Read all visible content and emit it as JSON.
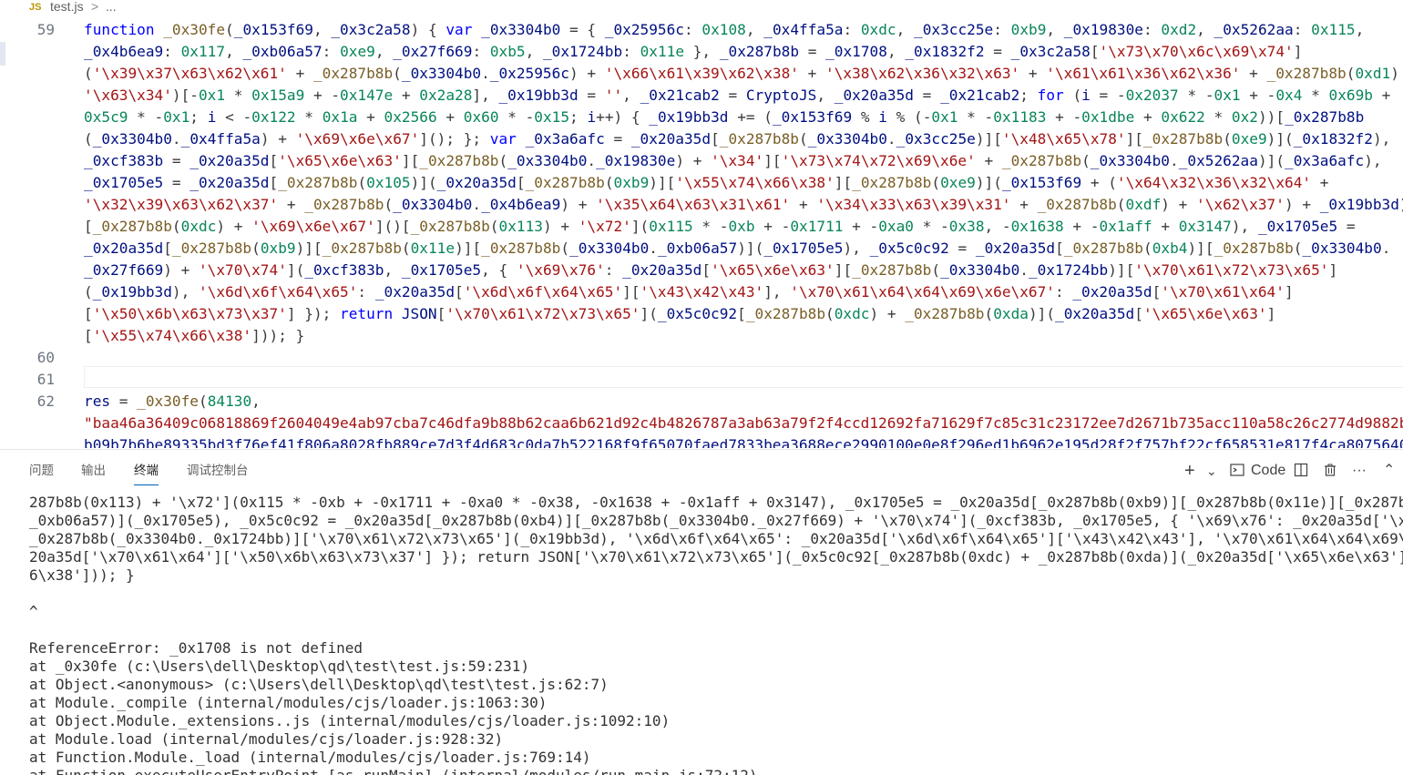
{
  "breadcrumb": {
    "icon_label": "JS",
    "file": "test.js",
    "separator": ">",
    "more": "..."
  },
  "editor": {
    "line_numbers": [
      "59",
      "60",
      "61",
      "62"
    ],
    "line59": [
      "function _0x30fe(_0x153f69, _0x3c2a58) { var _0x3304b0 = { _0x25956c: 0x108, _0x4ffa5a: 0xdc, _0x3cc25e: 0xb9, _0x19830e: 0xd2, _0x5262aa: 0x115,",
      "_0x4b6ea9: 0x117, _0xb06a57: 0xe9, _0x27f669: 0xb5, _0x1724bb: 0x11e }, _0x287b8b = _0x1708, _0x1832f2 = _0x3c2a58['\\x73\\x70\\x6c\\x69\\x74']",
      "('\\x39\\x37\\x63\\x62\\x61' + _0x287b8b(_0x3304b0._0x25956c) + '\\x66\\x61\\x39\\x62\\x38' + '\\x38\\x62\\x36\\x32\\x63' + '\\x61\\x61\\x36\\x62\\x36' + _0x287b8b(0xd1) +",
      "'\\x63\\x34')[-0x1 * 0x15a9 + -0x147e + 0x2a28], _0x19bb3d = '', _0x21cab2 = CryptoJS, _0x20a35d = _0x21cab2; for (i = -0x2037 * -0x1 + -0x4 * 0x69b +",
      "0x5c9 * -0x1; i < -0x122 * 0x1a + 0x2566 + 0x60 * -0x15; i++) { _0x19bb3d += (_0x153f69 % i % (-0x1 * -0x1183 + -0x1dbe + 0x622 * 0x2))[_0x287b8b",
      "(_0x3304b0._0x4ffa5a) + '\\x69\\x6e\\x67'](); }; var _0x3a6afc = _0x20a35d[_0x287b8b(_0x3304b0._0x3cc25e)]['\\x48\\x65\\x78'][_0x287b8b(0xe9)](_0x1832f2),",
      "_0xcf383b = _0x20a35d['\\x65\\x6e\\x63'][_0x287b8b(_0x3304b0._0x19830e) + '\\x34']['\\x73\\x74\\x72\\x69\\x6e' + _0x287b8b(_0x3304b0._0x5262aa)](_0x3a6afc),",
      "_0x1705e5 = _0x20a35d[_0x287b8b(0x105)](_0x20a35d[_0x287b8b(0xb9)]['\\x55\\x74\\x66\\x38'][_0x287b8b(0xe9)](_0x153f69 + ('\\x64\\x32\\x36\\x32\\x64' +",
      "'\\x32\\x39\\x63\\x62\\x37' + _0x287b8b(_0x3304b0._0x4b6ea9) + '\\x35\\x64\\x63\\x31\\x61' + '\\x34\\x33\\x63\\x39\\x31' + _0x287b8b(0xdf) + '\\x62\\x37') + _0x19bb3d)",
      "[_0x287b8b(0xdc) + '\\x69\\x6e\\x67']()[_0x287b8b(0x113) + '\\x72'](0x115 * -0xb + -0x1711 + -0xa0 * -0x38, -0x1638 + -0x1aff + 0x3147), _0x1705e5 =",
      "_0x20a35d[_0x287b8b(0xb9)][_0x287b8b(0x11e)][_0x287b8b(_0x3304b0._0xb06a57)](_0x1705e5), _0x5c0c92 = _0x20a35d[_0x287b8b(0xb4)][_0x287b8b(_0x3304b0.",
      "_0x27f669) + '\\x70\\x74'](_0xcf383b, _0x1705e5, { '\\x69\\x76': _0x20a35d['\\x65\\x6e\\x63'][_0x287b8b(_0x3304b0._0x1724bb)]['\\x70\\x61\\x72\\x73\\x65']",
      "(_0x19bb3d), '\\x6d\\x6f\\x64\\x65': _0x20a35d['\\x6d\\x6f\\x64\\x65']['\\x43\\x42\\x43'], '\\x70\\x61\\x64\\x64\\x69\\x6e\\x67': _0x20a35d['\\x70\\x61\\x64']",
      "['\\x50\\x6b\\x63\\x73\\x37'] }); return JSON['\\x70\\x61\\x72\\x73\\x65'](_0x5c0c92[_0x287b8b(0xdc) + _0x287b8b(0xda)](_0x20a35d['\\x65\\x6e\\x63']",
      "['\\x55\\x74\\x66\\x38'])); }"
    ],
    "line62": [
      "res = _0x30fe(84130,",
      "\"baa46a36409c06818869f2604049e4ab97cba7c46dfa9b88b62caa6b621d92c4b4826787a3ab63a79f2f4ccd12692fa71629f7c85c31c23172ee7d2671b735acc110a58c26c2774d9882b7",
      "b09b7b6be89335bd3f76ef41f806a8028fb889ce7d3f4d683c0da7b522168f9f65070faed7833bea3688ece2990100e0e8f296ed1b6962e195d28f2f757bf22cf658531e817f4ca8075640"
    ]
  },
  "panel": {
    "tabs": [
      "问题",
      "输出",
      "终端",
      "调试控制台"
    ],
    "active_tab": "终端",
    "tools": {
      "add": "+",
      "dropdown": "⌄",
      "code_label": "Code",
      "more": "···",
      "collapse": "⌃"
    }
  },
  "terminal": {
    "lines": [
      "287b8b(0x113) + '\\x72'](0x115 * -0xb + -0x1711 + -0xa0 * -0x38, -0x1638 + -0x1aff + 0x3147), _0x1705e5 = _0x20a35d[_0x287b8b(0xb9)][_0x287b8b(0x11e)][_0x287b8b(_0x3304b",
      "_0xb06a57)](_0x1705e5), _0x5c0c92 = _0x20a35d[_0x287b8b(0xb4)][_0x287b8b(_0x3304b0._0x27f669) + '\\x70\\x74'](_0xcf383b, _0x1705e5, { '\\x69\\x76': _0x20a35d['\\x65\\x6e\\x63'",
      "_0x287b8b(_0x3304b0._0x1724bb)]['\\x70\\x61\\x72\\x73\\x65'](_0x19bb3d), '\\x6d\\x6f\\x64\\x65': _0x20a35d['\\x6d\\x6f\\x64\\x65']['\\x43\\x42\\x43'], '\\x70\\x61\\x64\\x64\\x69\\x6e\\x67': _",
      "20a35d['\\x70\\x61\\x64']['\\x50\\x6b\\x63\\x73\\x37'] }); return JSON['\\x70\\x61\\x72\\x73\\x65'](_0x5c0c92[_0x287b8b(0xdc) + _0x287b8b(0xda)](_0x20a35d['\\x65\\x6e\\x63']['\\x55\\x74\\x",
      "6\\x38'])); }",
      "",
      "                                                ^",
      "",
      "ReferenceError: _0x1708 is not defined",
      "    at _0x30fe (c:\\Users\\dell\\Desktop\\qd\\test\\test.js:59:231)",
      "    at Object.<anonymous> (c:\\Users\\dell\\Desktop\\qd\\test\\test.js:62:7)",
      "    at Module._compile (internal/modules/cjs/loader.js:1063:30)",
      "    at Object.Module._extensions..js (internal/modules/cjs/loader.js:1092:10)",
      "    at Module.load (internal/modules/cjs/loader.js:928:32)",
      "    at Function.Module._load (internal/modules/cjs/loader.js:769:14)",
      "    at Function.executeUserEntryPoint [as runMain] (internal/modules/run_main.js:72:12)"
    ]
  },
  "colors": {
    "keyword": "#0000ff",
    "variable": "#001080",
    "string": "#a31515",
    "number": "#098658",
    "function": "#795e26",
    "active_tab_border": "#005fb8"
  }
}
